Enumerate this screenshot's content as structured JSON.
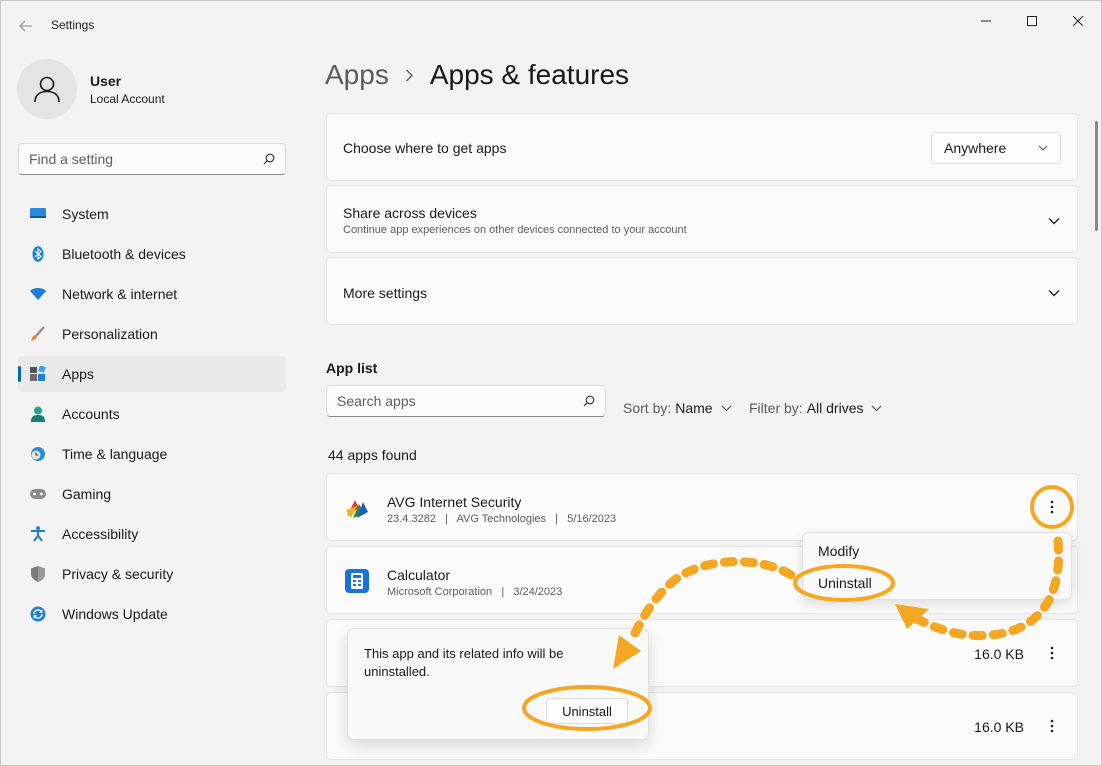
{
  "window": {
    "title": "Settings",
    "controls": [
      "minimize",
      "maximize",
      "close"
    ]
  },
  "profile": {
    "name": "User",
    "account_type": "Local Account"
  },
  "search": {
    "placeholder": "Find a setting"
  },
  "sidebar": {
    "items": [
      {
        "label": "System",
        "icon": "system-icon"
      },
      {
        "label": "Bluetooth & devices",
        "icon": "bluetooth-icon"
      },
      {
        "label": "Network & internet",
        "icon": "wifi-icon"
      },
      {
        "label": "Personalization",
        "icon": "brush-icon"
      },
      {
        "label": "Apps",
        "icon": "apps-icon",
        "active": true
      },
      {
        "label": "Accounts",
        "icon": "accounts-icon"
      },
      {
        "label": "Time & language",
        "icon": "clock-globe-icon"
      },
      {
        "label": "Gaming",
        "icon": "gamepad-icon"
      },
      {
        "label": "Accessibility",
        "icon": "accessibility-icon"
      },
      {
        "label": "Privacy & security",
        "icon": "shield-icon"
      },
      {
        "label": "Windows Update",
        "icon": "update-icon"
      }
    ]
  },
  "breadcrumb": {
    "parent": "Apps",
    "current": "Apps & features"
  },
  "cards": {
    "where_title": "Choose where to get apps",
    "where_value": "Anywhere",
    "share_title": "Share across devices",
    "share_sub": "Continue app experiences on other devices connected to your account",
    "more_title": "More settings"
  },
  "app_list": {
    "heading": "App list",
    "search_placeholder": "Search apps",
    "sort_label": "Sort by:",
    "sort_value": "Name",
    "filter_label": "Filter by:",
    "filter_value": "All drives",
    "count": "44 apps found",
    "apps": [
      {
        "name": "AVG Internet Security",
        "meta": "23.4.3282   |   AVG Technologies   |   5/16/2023",
        "size": ""
      },
      {
        "name": "Calculator",
        "meta": "Microsoft Corporation   |   3/24/2023",
        "size": ""
      },
      {
        "name": "",
        "meta": "",
        "size": "16.0 KB"
      },
      {
        "name": "",
        "meta": "",
        "size": "16.0 KB"
      }
    ]
  },
  "context_menu": {
    "items": [
      "Modify",
      "Uninstall"
    ]
  },
  "confirm_dialog": {
    "message": "This app and its related info will be uninstalled.",
    "button": "Uninstall"
  },
  "colors": {
    "accent": "#0067c0",
    "annotation": "#f5a623",
    "window_bg": "#f3f3f3",
    "card_bg": "#fbfbfb"
  }
}
